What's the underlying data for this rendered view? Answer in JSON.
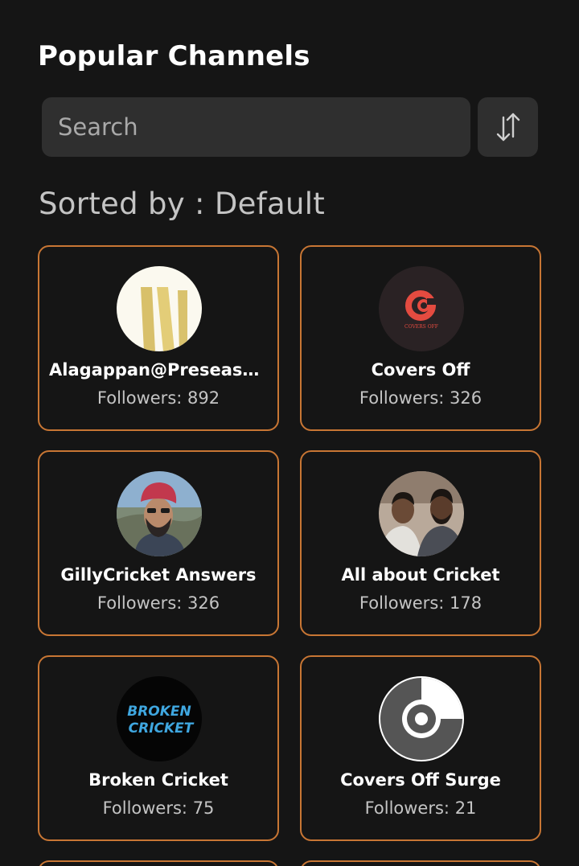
{
  "header": {
    "title": "Popular Channels"
  },
  "search": {
    "placeholder": "Search"
  },
  "sort": {
    "label": "Sorted by : Default"
  },
  "followers_label": "Followers: ",
  "accent_color": "#c87634",
  "channels": [
    {
      "name": "Alagappan@Preseaso...",
      "followers": "892",
      "avatar": "yellow-stripes-logo"
    },
    {
      "name": "Covers Off",
      "followers": "326",
      "avatar": "covers-off-logo"
    },
    {
      "name": "GillyCricket Answers",
      "followers": "326",
      "avatar": "person-photo"
    },
    {
      "name": "All about Cricket",
      "followers": "178",
      "avatar": "two-person-photo"
    },
    {
      "name": "Broken Cricket",
      "followers": "75",
      "avatar": "broken-cricket-logo"
    },
    {
      "name": "Covers Off Surge",
      "followers": "21",
      "avatar": "disc-logo"
    }
  ],
  "avatar_texts": {
    "covers_off": "COVERS OFF",
    "broken_line1": "BROKEN",
    "broken_line2": "CRICKET"
  }
}
